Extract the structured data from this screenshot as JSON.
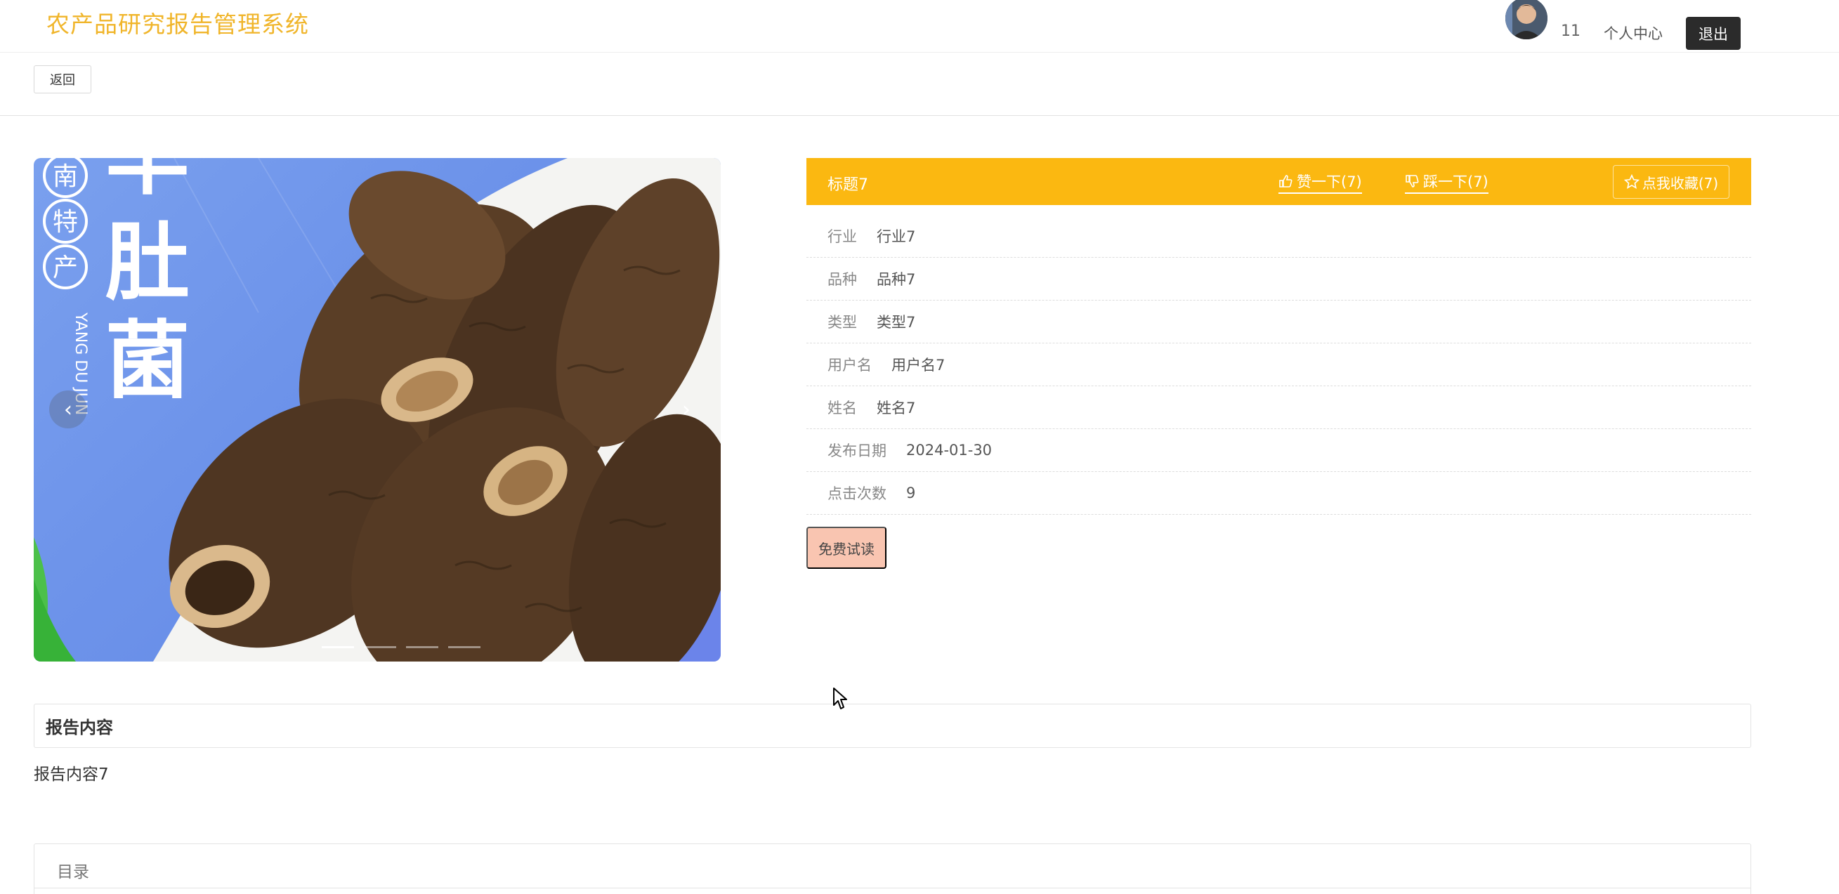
{
  "header": {
    "app_title": "农产品研究报告管理系统",
    "user_id": "11",
    "profile_label": "个人中心",
    "logout_label": "退出"
  },
  "toolbar": {
    "back_label": "返回"
  },
  "carousel": {
    "prev_symbol": "‹",
    "next_symbol": "›",
    "slide_count": 4,
    "active_index": 0,
    "image_text": {
      "vertical_left": [
        "南",
        "特",
        "产"
      ],
      "big_chars": [
        "羊",
        "肚",
        "菌"
      ],
      "pinyin": "YANG DU JUN"
    }
  },
  "detail": {
    "title": "标题7",
    "like_label": "赞一下(7)",
    "dislike_label": "踩一下(7)",
    "collect_label": "点我收藏(7)",
    "accent_color": "#fbb811",
    "fields": [
      {
        "label": "行业",
        "value": "行业7"
      },
      {
        "label": "品种",
        "value": "品种7"
      },
      {
        "label": "类型",
        "value": "类型7"
      },
      {
        "label": "用户名",
        "value": "用户名7"
      },
      {
        "label": "姓名",
        "value": "姓名7"
      },
      {
        "label": "发布日期",
        "value": "2024-01-30"
      },
      {
        "label": "点击次数",
        "value": "9"
      }
    ],
    "trial_label": "免费试读"
  },
  "report": {
    "heading": "报告内容",
    "text": "报告内容7"
  },
  "toc": {
    "heading": "目录"
  },
  "icons": {
    "like": "thumbs-up-icon",
    "dislike": "thumbs-down-icon",
    "collect": "star-icon",
    "cursor": "mouse-cursor-icon"
  }
}
